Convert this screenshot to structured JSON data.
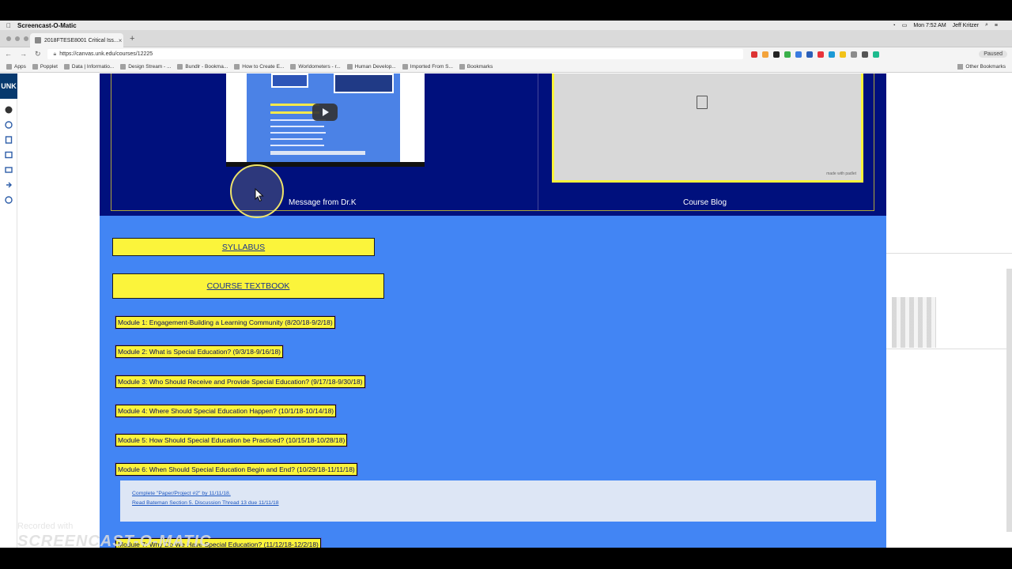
{
  "menubar": {
    "app_name": "Screencast-O-Matic",
    "clock": "Mon 7:52 AM",
    "user": "Jeff Kritzer"
  },
  "browser": {
    "tab_title": "2018FTESE8001 Critical Iss...",
    "url": "https://canvas.unk.edu/courses/12225",
    "paused_label": "Paused",
    "bookmarks": [
      "Apps",
      "Popplet",
      "Data | Informatio...",
      "Design Stream - ...",
      "Bundlr - Bookma...",
      "How to Create E...",
      "Worldometers - r...",
      "Human Develop...",
      "Imported From S...",
      "Bookmarks"
    ],
    "other_bookmarks": "Other Bookmarks"
  },
  "sidebar": {
    "logo": "UNK"
  },
  "course": {
    "video_caption": "Message from Dr.K",
    "blog_caption": "Course Blog",
    "padlet_credit": "made with padlet",
    "syllabus": "SYLLABUS",
    "textbook": "COURSE TEXTBOOK",
    "modules": [
      "Module 1: Engagement-Building a Learning Community (8/20/18-9/2/18)",
      "Module 2: What is Special Education? (9/3/18-9/16/18)",
      "Module 3: Who Should Receive and Provide Special Education? (9/17/18-9/30/18)",
      "Module 4: Where Should Special Education Happen? (10/1/18-10/14/18)",
      "Module 5: How Should Special Education be Practiced? (10/15/18-10/28/18)",
      "Module 6: When Should Special Education Begin and End? (10/29/18-11/11/18)",
      "Module 7: Why Do We Have Special Education? (11/12/18-12/2/18)"
    ],
    "module6_items": [
      "Complete \"Paper/Project #2\" by 11/11/18.",
      "Read Bateman Section 5. Discussion Thread 13 due 11/11/18"
    ]
  },
  "watermark": {
    "recorded": "Recorded with",
    "brand": "SCREENCAST-O-MATIC"
  }
}
